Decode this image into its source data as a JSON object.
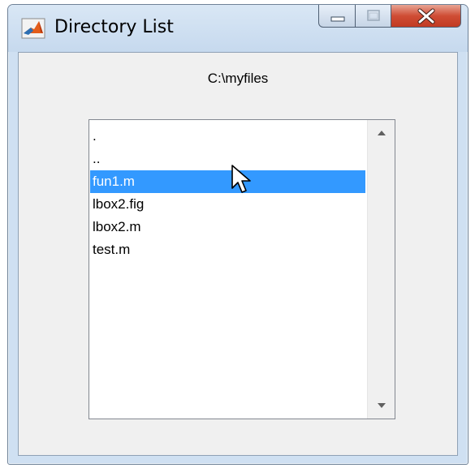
{
  "window": {
    "title": "Directory List"
  },
  "header": {
    "path": "C:\\myfiles"
  },
  "listbox": {
    "items": [
      ".",
      "..",
      "fun1.m",
      "lbox2.fig",
      "lbox2.m",
      "test.m"
    ],
    "selected_item": "fun1.m"
  },
  "icons": {
    "app": "matlab-icon",
    "minimize": "minimize-icon",
    "maximize": "maximize-icon",
    "close": "close-icon",
    "scroll_up": "scroll-up-arrow-icon",
    "scroll_down": "scroll-down-arrow-icon",
    "cursor": "mouse-pointer-icon"
  },
  "colors": {
    "selection": "#3399ff",
    "close_button": "#c9452d"
  }
}
